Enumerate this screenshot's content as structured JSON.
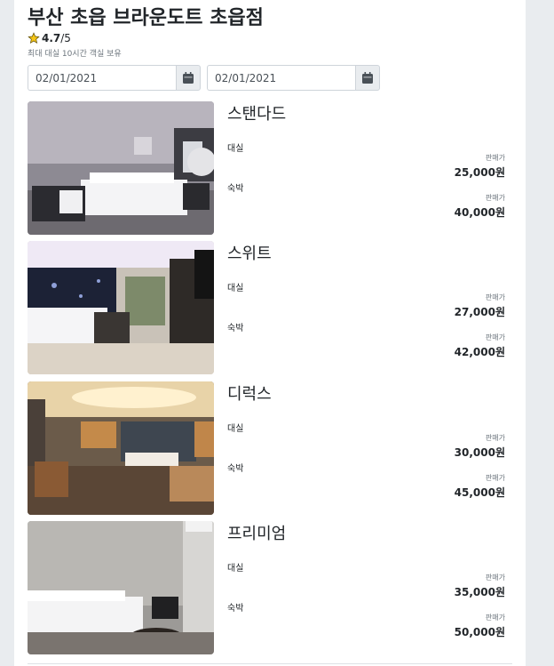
{
  "hotel": {
    "title": "부산 초읍 브라운도트 초읍점",
    "rating": "4.7",
    "rating_max": "/5",
    "subtitle": "최대 대실 10시간 객실 보유"
  },
  "dates": {
    "checkin": "02/01/2021",
    "checkout": "02/01/2021"
  },
  "icons": {
    "rating": "star-icon",
    "date": "calendar-icon"
  },
  "rooms": [
    {
      "name": "스탠다드",
      "options": [
        {
          "label": "대실",
          "price_label": "판매가",
          "price": "25,000원"
        },
        {
          "label": "숙박",
          "price_label": "판매가",
          "price": "40,000원"
        }
      ]
    },
    {
      "name": "스위트",
      "options": [
        {
          "label": "대실",
          "price_label": "판매가",
          "price": "27,000원"
        },
        {
          "label": "숙박",
          "price_label": "판매가",
          "price": "42,000원"
        }
      ]
    },
    {
      "name": "디럭스",
      "options": [
        {
          "label": "대실",
          "price_label": "판매가",
          "price": "30,000원"
        },
        {
          "label": "숙박",
          "price_label": "판매가",
          "price": "45,000원"
        }
      ]
    },
    {
      "name": "프리미엄",
      "options": [
        {
          "label": "대실",
          "price_label": "판매가",
          "price": "35,000원"
        },
        {
          "label": "숙박",
          "price_label": "판매가",
          "price": "50,000원"
        }
      ]
    }
  ],
  "colors": {
    "star": "#f5c518",
    "page_bg": "#e9ecef"
  }
}
